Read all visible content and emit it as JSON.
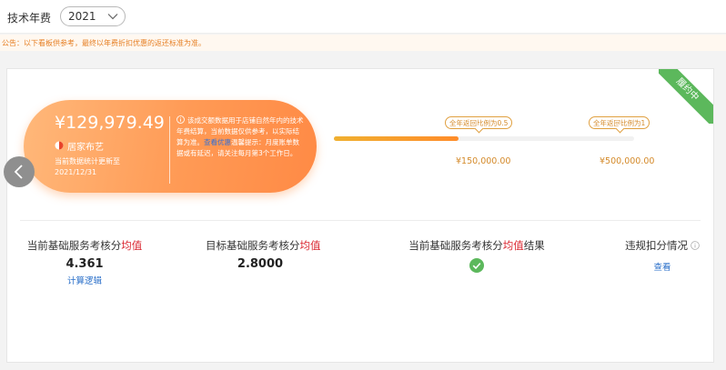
{
  "header": {
    "label": "技术年费",
    "year_select": {
      "value": "2021"
    }
  },
  "notice": "公告：以下看板供参考，最终以年费折扣优惠的返还标准为准。",
  "card": {
    "status_ribbon": "履约中",
    "amount": "¥129,979.49",
    "brand_name": "居家布艺",
    "update_note": "当前数据统计更新至 2021/12/31",
    "info_text_1": "该成交额数据用于店铺自然年内的技术年费结算，当前数据仅供参考，以实际结算为准。",
    "info_link": "查看优惠",
    "info_text_2": "温馨提示：月度账单数据或有延迟，请关注每月第3个工作日。",
    "progress": {
      "fill_fraction": 0.415,
      "milestones": [
        {
          "label": "全年返回比例为0.5",
          "value": "¥150,000.00"
        },
        {
          "label": "全年返回比例为1",
          "value": "¥500,000.00"
        }
      ]
    },
    "metrics": [
      {
        "title_prefix": "当前基础服务考核分",
        "title_highlight": "均值",
        "title_suffix": "",
        "value": "4.361",
        "link": "计算逻辑"
      },
      {
        "title_prefix": "目标基础服务考核分",
        "title_highlight": "均值",
        "title_suffix": "",
        "value": "2.8000"
      },
      {
        "title_prefix": "当前基础服务考核分",
        "title_highlight": "均值",
        "title_suffix": "结果",
        "result_icon": "check-circle-icon"
      },
      {
        "title_prefix": "违规扣分情况",
        "link": "查看"
      }
    ]
  },
  "colors": {
    "accent_orange": "#ff8c2a",
    "highlight_red": "#d9232d",
    "link_blue": "#2a6fc9",
    "success_green": "#5cb85c"
  }
}
